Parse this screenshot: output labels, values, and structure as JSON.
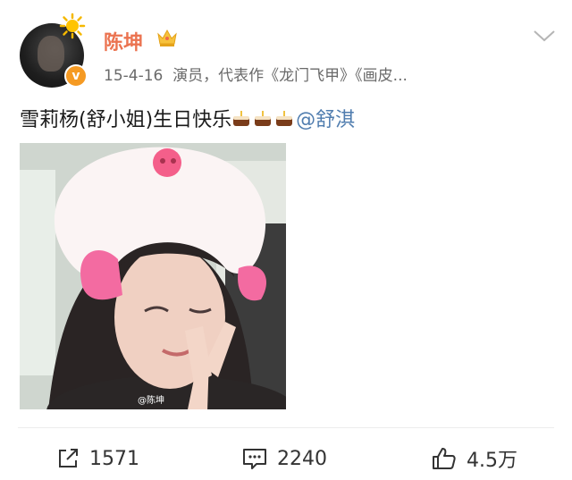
{
  "header": {
    "username": "陈坤",
    "timestamp": "15-4-16",
    "description": "演员，代表作《龙门飞甲》《画皮...",
    "badge_text": "v"
  },
  "post": {
    "text": "雪莉杨(舒小姐)生日快乐",
    "mention": "@舒淇"
  },
  "photo": {
    "watermark": "@陈坤"
  },
  "actions": {
    "repost_count": "1571",
    "comment_count": "2240",
    "like_count": "4.5万"
  },
  "colors": {
    "username": "#eb7350",
    "mention": "#507daf",
    "verified": "#f59a23"
  }
}
